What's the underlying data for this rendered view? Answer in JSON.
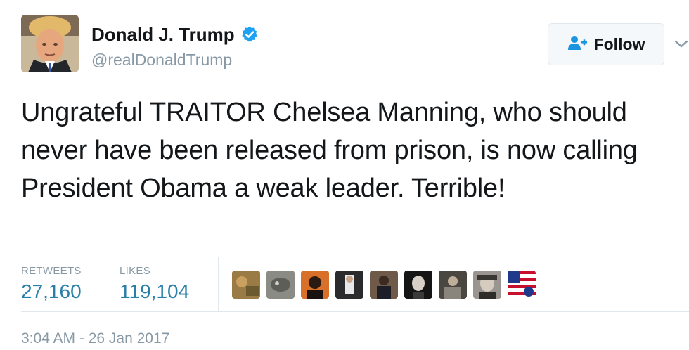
{
  "user": {
    "name": "Donald J. Trump",
    "handle": "@realDonaldTrump",
    "verified": true
  },
  "follow": {
    "label": "Follow"
  },
  "tweet": {
    "text": "Ungrateful TRAITOR Chelsea Manning, who should never have been released from prison, is now calling President Obama a weak leader. Terrible!"
  },
  "stats": {
    "retweets_label": "RETWEETS",
    "retweets_value": "27,160",
    "likes_label": "LIKES",
    "likes_value": "119,104"
  },
  "timestamp": "3:04 AM - 26 Jan 2017",
  "colors": {
    "link_blue": "#2a7fa8",
    "verified_blue": "#1da1f2",
    "muted_gray": "#8899a6",
    "border_gray": "#e1e8ed"
  }
}
